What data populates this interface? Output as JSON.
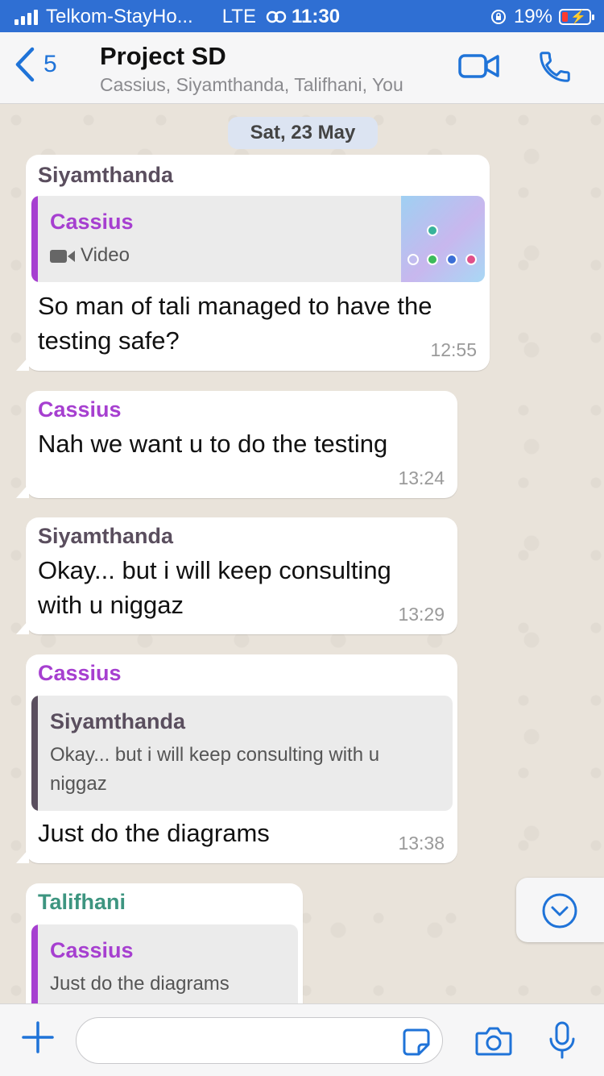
{
  "status_bar": {
    "carrier": "Telkom-StayHo...",
    "network": "LTE",
    "time": "11:30",
    "battery": "19%"
  },
  "header": {
    "back_count": "5",
    "title": "Project SD",
    "participants": "Cassius, Siyamthanda, Talifhani, You"
  },
  "chat": {
    "date_label": "Sat, 23 May",
    "messages": [
      {
        "sender": "Siyamthanda",
        "quote": {
          "name": "Cassius",
          "media_label": "Video"
        },
        "text_line1": "So man of tali managed to have the",
        "text_line2": "testing safe?",
        "time": "12:55"
      },
      {
        "sender": "Cassius",
        "text_line1": "Nah we want u to do the testing",
        "time": "13:24"
      },
      {
        "sender": "Siyamthanda",
        "text_line1": "Okay... but i will keep consulting",
        "text_line2": "with u niggaz",
        "time": "13:29"
      },
      {
        "sender": "Cassius",
        "quote": {
          "name": "Siyamthanda",
          "text_line1": "Okay... but i will keep consulting with u",
          "text_line2": "niggaz"
        },
        "text_line1": "Just do the diagrams",
        "time": "13:38"
      },
      {
        "sender": "Talifhani",
        "quote": {
          "name": "Cassius",
          "text_line1": "Just do the diagrams"
        }
      }
    ]
  },
  "colors": {
    "accent": "#1f73d8",
    "cassius": "#a63fd0",
    "siyamthanda": "#5a4e5e",
    "talifhani": "#3d9580",
    "status_bar": "#2f6fd3"
  },
  "icons": {
    "back": "chevron-left-icon",
    "video_call": "video-camera-icon",
    "voice_call": "phone-icon",
    "media": "video-icon",
    "scroll": "chevron-down-circle-icon",
    "attach": "plus-icon",
    "sticker": "sticker-icon",
    "camera": "camera-icon",
    "mic": "microphone-icon"
  }
}
